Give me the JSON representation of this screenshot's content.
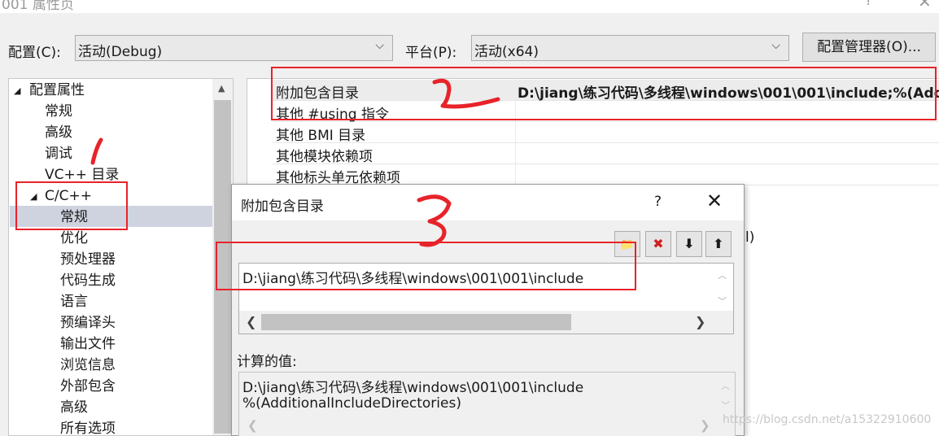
{
  "window": {
    "title": "001 属性页",
    "help": "?",
    "close": "✕"
  },
  "config": {
    "label": "配置(C):",
    "value": "活动(Debug)",
    "platform_label": "平台(P):",
    "platform_value": "活动(x64)",
    "manager_button": "配置管理器(O)..."
  },
  "tree": {
    "root": "配置属性",
    "items": [
      "常规",
      "高级",
      "调试",
      "VC++ 目录"
    ],
    "cpp": "C/C++",
    "cpp_children": [
      "常规",
      "优化",
      "预处理器",
      "代码生成",
      "语言",
      "预编译头",
      "输出文件",
      "浏览信息",
      "外部包含",
      "高级",
      "所有选项"
    ]
  },
  "grid": {
    "rows": [
      {
        "name": "附加包含目录",
        "value": "D:\\jiang\\练习代码\\多线程\\windows\\001\\001\\include;%(Add"
      },
      {
        "name": "其他 #using 指令",
        "value": ""
      },
      {
        "name": "其他 BMI 目录",
        "value": ""
      },
      {
        "name": "其他模块依赖项",
        "value": ""
      },
      {
        "name": "其他标头单元依赖项",
        "value": ""
      }
    ],
    "trailing": "l)"
  },
  "dialog": {
    "title": "附加包含目录",
    "help": "?",
    "close": "✕",
    "toolbar": {
      "new_folder": "📁",
      "delete": "✖",
      "move_down": "⬇",
      "move_up": "⬆"
    },
    "entries": [
      "D:\\jiang\\练习代码\\多线程\\windows\\001\\001\\include"
    ],
    "computed_label": "计算的值:",
    "computed_lines": [
      "D:\\jiang\\练习代码\\多线程\\windows\\001\\001\\include",
      "%(AdditionalIncludeDirectories)"
    ]
  },
  "annotations": {
    "mark_1": "1",
    "mark_2": "2",
    "mark_3": "3",
    "color": "#e8232a"
  },
  "watermark": "https://blog.csdn.net/a15322910600"
}
